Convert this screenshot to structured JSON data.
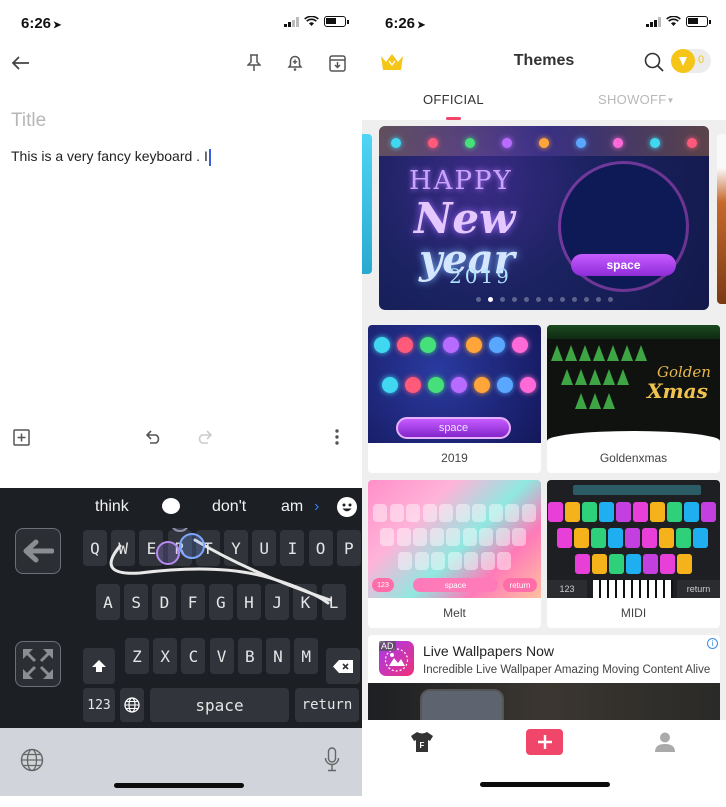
{
  "left": {
    "status": {
      "time": "6:26",
      "location_icon": "location-arrow-icon"
    },
    "toolbar": {
      "back_icon": "arrow-left-icon",
      "pin_icon": "pin-icon",
      "reminder_icon": "bell-plus-icon",
      "archive_icon": "archive-icon"
    },
    "note": {
      "title_placeholder": "Title",
      "body": "This is a very fancy keyboard . I"
    },
    "bottom_toolbar": {
      "add_icon": "add-box-icon",
      "undo_icon": "undo-icon",
      "redo_icon": "redo-icon",
      "more_icon": "more-vertical-icon"
    },
    "keyboard": {
      "suggestions": [
        "think",
        "don't",
        "am"
      ],
      "suggestion_bubble_icon": "thought-bubble-icon",
      "more_suggestions_icon": "chevron-right-icon",
      "emoji_icon": "smiley-icon",
      "side_buttons": [
        "back-arrow-icon",
        "expand-icon"
      ],
      "row1": [
        "Q",
        "W",
        "E",
        "R",
        "T",
        "Y",
        "U",
        "I",
        "O",
        "P"
      ],
      "row2": [
        "A",
        "S",
        "D",
        "F",
        "G",
        "H",
        "J",
        "K",
        "L"
      ],
      "row3": [
        "Z",
        "X",
        "C",
        "V",
        "B",
        "N",
        "M"
      ],
      "shift_icon": "shift-icon",
      "backspace_icon": "backspace-icon",
      "numbers_label": "123",
      "globe_icon": "globe-icon",
      "space_label": "space",
      "return_label": "return"
    },
    "system_bar": {
      "globe_icon": "globe-icon",
      "mic_icon": "microphone-icon"
    }
  },
  "right": {
    "status": {
      "time": "6:26"
    },
    "header": {
      "title": "Themes",
      "crown_icon": "crown-icon",
      "search_icon": "search-icon",
      "coins": "0"
    },
    "tabs": [
      {
        "label": "OFFICIAL",
        "active": true
      },
      {
        "label": "SHOWOFF",
        "active": false
      }
    ],
    "banner": {
      "headline": "HAPPY",
      "line2": "New",
      "line3": "year",
      "year": "2019",
      "space_label": "space",
      "slide_count": 12,
      "active_slide": 2
    },
    "themes": [
      {
        "name": "2019",
        "thumb_space": "space"
      },
      {
        "name": "Goldenxmas",
        "thumb_text1": "Golden",
        "thumb_text2": "Xmas"
      },
      {
        "name": "Melt",
        "thumb_space": "space",
        "thumb_return": "return",
        "thumb_num": "123"
      },
      {
        "name": "MIDI",
        "thumb_num": "123",
        "thumb_return": "return"
      }
    ],
    "ad": {
      "badge": "AD",
      "title": "Live Wallpapers Now",
      "description": "Incredible Live Wallpaper Amazing Moving Content Alive",
      "info_icon": "info-icon"
    },
    "tabbar": {
      "themes_icon": "tshirt-icon",
      "themes_letter": "F",
      "add_icon": "plus-icon",
      "profile_icon": "person-icon"
    },
    "colors": {
      "accent": "#f0466a",
      "gold": "#f5c518"
    }
  }
}
